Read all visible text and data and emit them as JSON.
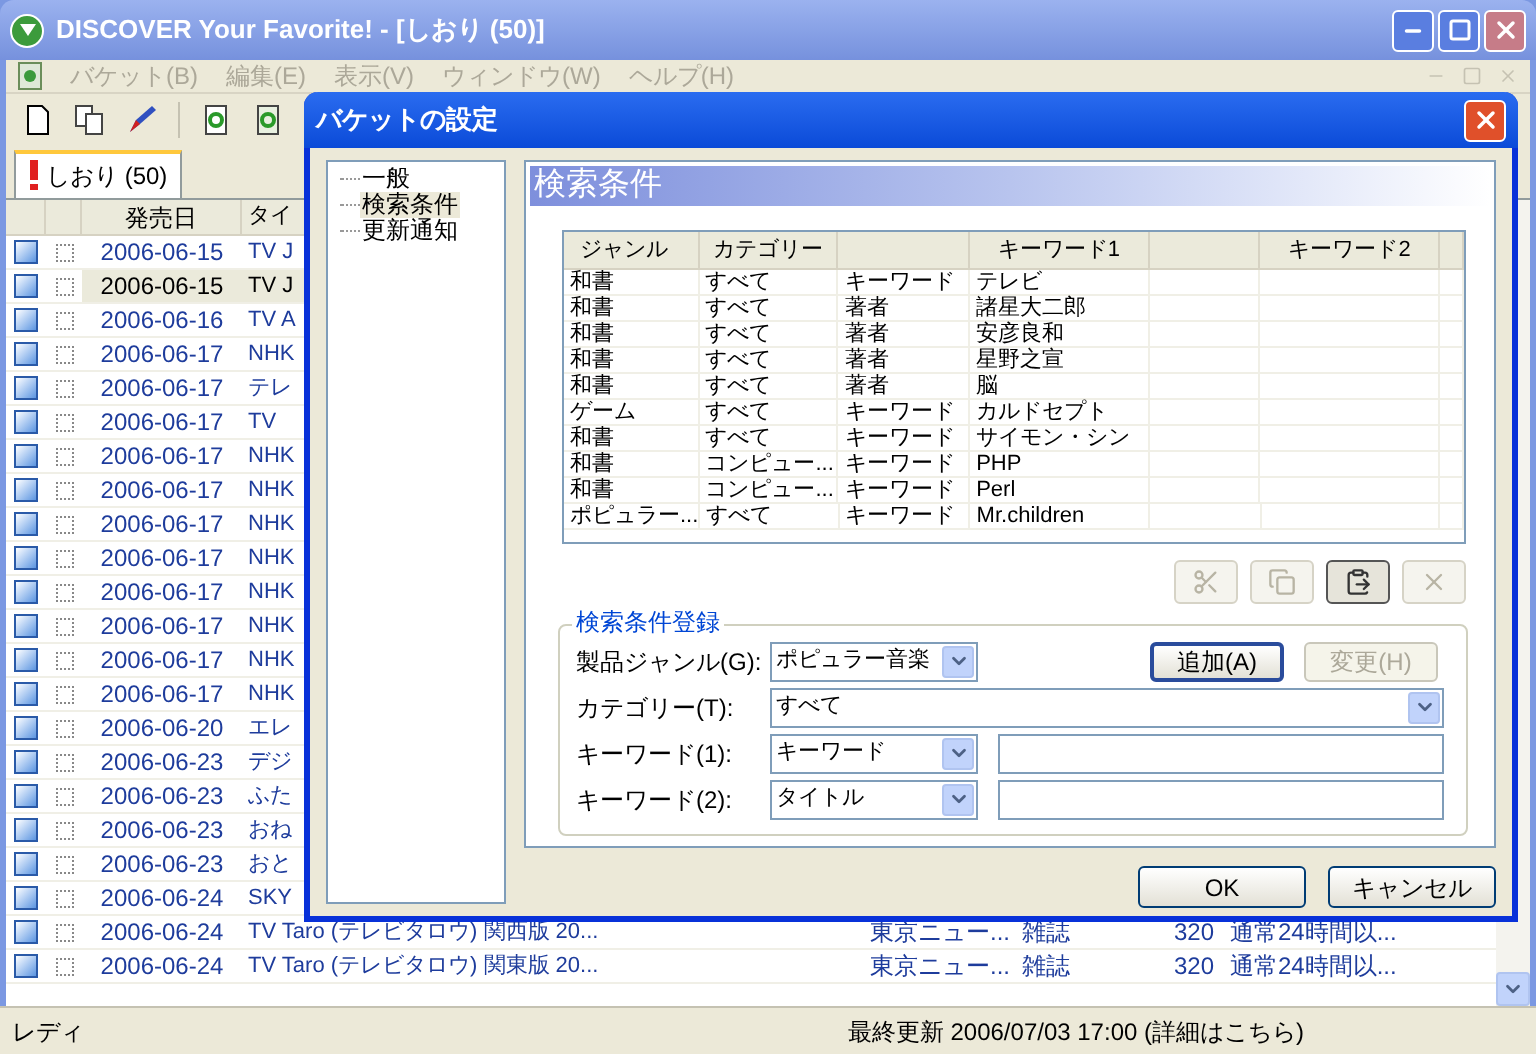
{
  "window": {
    "title": "DISCOVER Your Favorite! - [しおり (50)]"
  },
  "menu": [
    {
      "label": "バケット(B)"
    },
    {
      "label": "編集(E)"
    },
    {
      "label": "表示(V)"
    },
    {
      "label": "ウィンドウ(W)"
    },
    {
      "label": "ヘルプ(H)"
    }
  ],
  "tab": {
    "label": "しおり (50)"
  },
  "list": {
    "columns": [
      "発売日",
      "タイ"
    ],
    "rows": [
      {
        "checked": false,
        "selected": false,
        "cells": [
          "2006-06-15",
          "TV J"
        ]
      },
      {
        "checked": false,
        "selected": true,
        "cells": [
          "2006-06-15",
          "TV J"
        ]
      },
      {
        "checked": false,
        "selected": false,
        "cells": [
          "2006-06-16",
          "TV A"
        ]
      },
      {
        "checked": false,
        "selected": false,
        "cells": [
          "2006-06-17",
          "NHK"
        ]
      },
      {
        "checked": false,
        "selected": false,
        "cells": [
          "2006-06-17",
          "テレ"
        ]
      },
      {
        "checked": false,
        "selected": false,
        "cells": [
          "2006-06-17",
          "TV"
        ]
      },
      {
        "checked": false,
        "selected": false,
        "cells": [
          "2006-06-17",
          "NHK"
        ]
      },
      {
        "checked": false,
        "selected": false,
        "cells": [
          "2006-06-17",
          "NHK"
        ]
      },
      {
        "checked": false,
        "selected": false,
        "cells": [
          "2006-06-17",
          "NHK"
        ]
      },
      {
        "checked": false,
        "selected": false,
        "cells": [
          "2006-06-17",
          "NHK"
        ]
      },
      {
        "checked": false,
        "selected": false,
        "cells": [
          "2006-06-17",
          "NHK"
        ]
      },
      {
        "checked": false,
        "selected": false,
        "cells": [
          "2006-06-17",
          "NHK"
        ]
      },
      {
        "checked": false,
        "selected": false,
        "cells": [
          "2006-06-17",
          "NHK"
        ]
      },
      {
        "checked": false,
        "selected": false,
        "cells": [
          "2006-06-17",
          "NHK"
        ]
      },
      {
        "checked": false,
        "selected": false,
        "cells": [
          "2006-06-20",
          "エレ"
        ]
      },
      {
        "checked": false,
        "selected": false,
        "cells": [
          "2006-06-23",
          "デジ"
        ]
      },
      {
        "checked": false,
        "selected": false,
        "cells": [
          "2006-06-23",
          "ふた"
        ]
      },
      {
        "checked": false,
        "selected": false,
        "cells": [
          "2006-06-23",
          "おね"
        ]
      },
      {
        "checked": false,
        "selected": false,
        "cells": [
          "2006-06-23",
          "おと"
        ]
      },
      {
        "checked": false,
        "selected": false,
        "cells": [
          "2006-06-24",
          "SKY"
        ]
      },
      {
        "checked": false,
        "selected": false,
        "cells": [
          "2006-06-24",
          "TV Taro (テレビタロウ) 関西版 20...",
          "東京ニュー...",
          "雑誌",
          "320",
          "通常24時間以..."
        ]
      },
      {
        "checked": false,
        "selected": false,
        "cells": [
          "2006-06-24",
          "TV Taro (テレビタロウ) 関東版 20...",
          "東京ニュー...",
          "雑誌",
          "320",
          "通常24時間以..."
        ]
      }
    ]
  },
  "status_bar": [
    "レディ",
    "最終更新 2006/07/03 17:00 (詳細はこちら)"
  ],
  "dialog": {
    "title": "バケットの設定",
    "tree": [
      {
        "label": "一般",
        "selected": false
      },
      {
        "label": "検索条件",
        "selected": true
      },
      {
        "label": "更新通知",
        "selected": false
      }
    ],
    "heading": "検索条件",
    "conditions": {
      "columns": [
        "ジャンル",
        "カテゴリー",
        "",
        "キーワード1",
        "",
        "キーワード2"
      ],
      "rows": [
        [
          "和書",
          "すべて",
          "キーワード",
          "テレビ"
        ],
        [
          "和書",
          "すべて",
          "著者",
          "諸星大二郎"
        ],
        [
          "和書",
          "すべて",
          "著者",
          "安彦良和"
        ],
        [
          "和書",
          "すべて",
          "著者",
          "星野之宣"
        ],
        [
          "和書",
          "すべて",
          "著者",
          "脳"
        ],
        [
          "ゲーム",
          "すべて",
          "キーワード",
          "カルドセプト"
        ],
        [
          "和書",
          "すべて",
          "キーワード",
          "サイモン・シン"
        ],
        [
          "和書",
          "コンピュー...",
          "キーワード",
          "PHP"
        ],
        [
          "和書",
          "コンピュー...",
          "キーワード",
          "Perl"
        ],
        [
          "ポピュラー...",
          "すべて",
          "キーワード",
          "Mr.children"
        ]
      ]
    },
    "edit_buttons": [
      {
        "kind": "cut",
        "disabled": true
      },
      {
        "kind": "copy",
        "disabled": true
      },
      {
        "kind": "paste",
        "disabled": false
      },
      {
        "kind": "delete",
        "disabled": true
      }
    ],
    "register": {
      "title": "検索条件登録",
      "fields": [
        {
          "kind": "combo",
          "label": "製品ジャンル(G):",
          "value": "ポピュラー音楽"
        },
        {
          "kind": "wide",
          "label": "カテゴリー(T):",
          "value": "すべて"
        },
        {
          "kind": "combo_text",
          "label": "キーワード(1):",
          "value": "キーワード"
        },
        {
          "kind": "combo_text",
          "label": "キーワード(2):",
          "value": "タイトル"
        }
      ],
      "actions": [
        {
          "label": "追加(A)",
          "disabled": false
        },
        {
          "label": "変更(H)",
          "disabled": true
        }
      ]
    },
    "buttons": [
      {
        "label": "OK"
      },
      {
        "label": "キャンセル"
      }
    ]
  }
}
